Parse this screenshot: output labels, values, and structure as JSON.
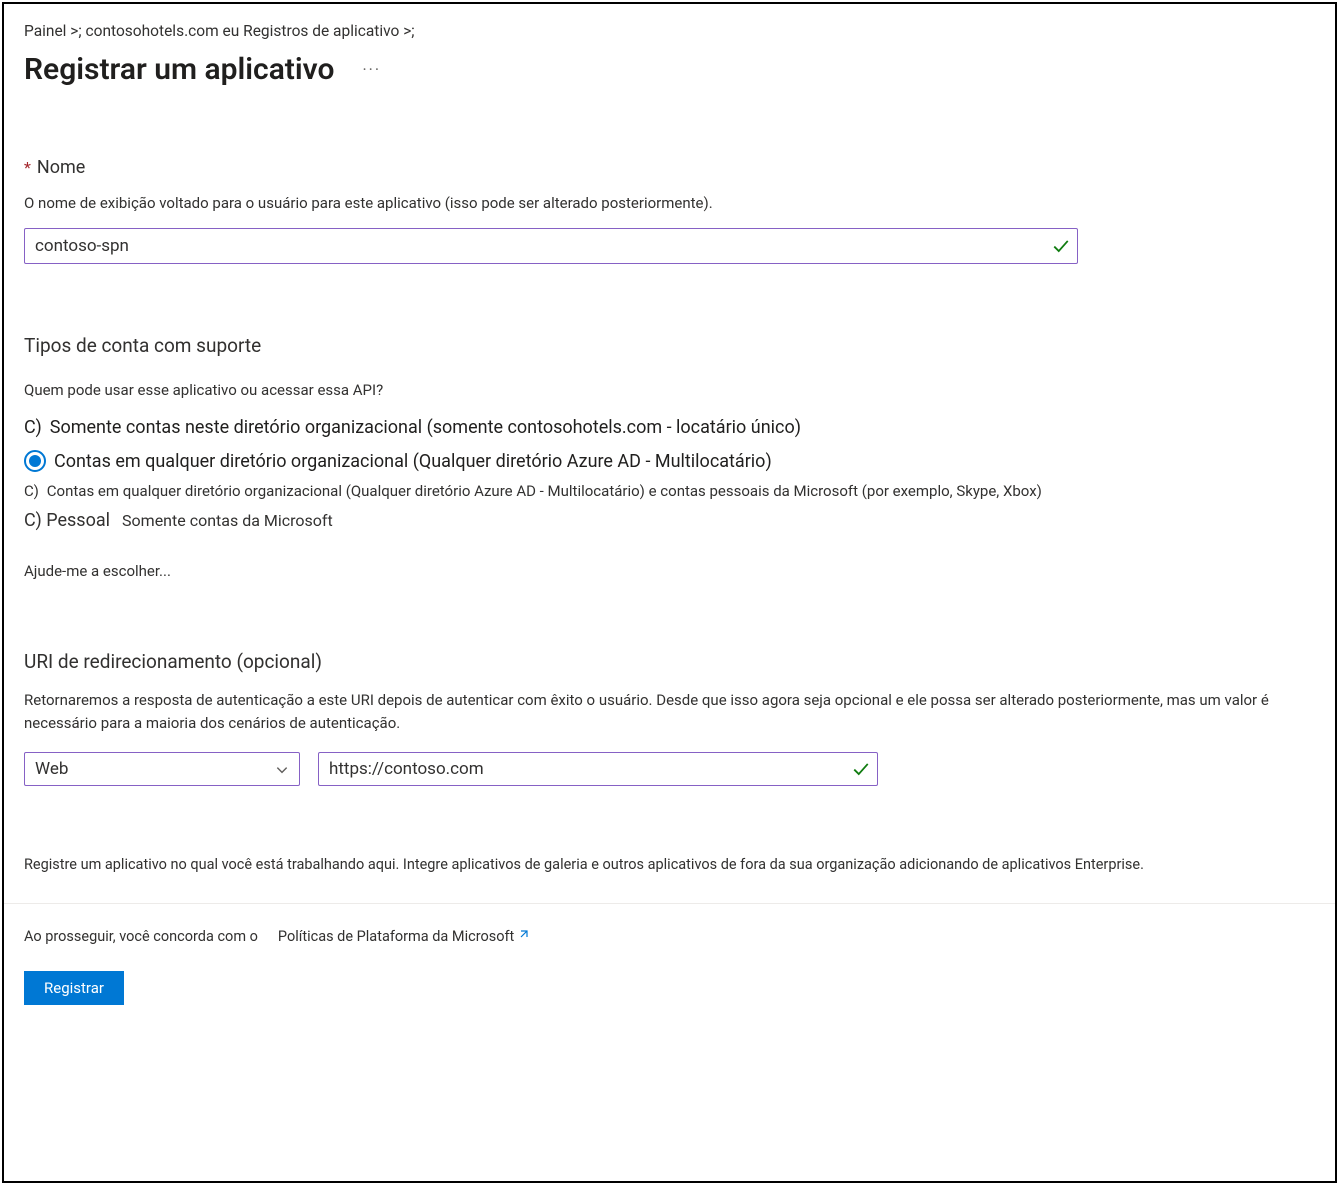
{
  "breadcrumb": "Painel >; contosohotels.com eu Registros de aplicativo >;",
  "page_title": "Registrar um aplicativo",
  "more_icon_name": "more-horizontal-icon",
  "name_section": {
    "required_star": "*",
    "label": "Nome",
    "description": "O nome de exibição voltado para o usuário para este aplicativo (isso pode ser alterado posteriormente).",
    "value": "contoso-spn"
  },
  "account_types": {
    "heading": "Tipos de conta com suporte",
    "sub": "Quem pode usar esse aplicativo ou acessar essa API?",
    "options": {
      "single_tenant_prefix": "C)",
      "single_tenant": "Somente contas neste diretório organizacional (somente contosohotels.com - locatário único)",
      "multi_tenant": "Contas em qualquer diretório organizacional (Qualquer diretório Azure AD - Multilocatário)",
      "multi_tenant_personal_prefix": "C)",
      "multi_tenant_personal": "Contas em qualquer diretório organizacional (Qualquer diretório Azure AD - Multilocatário) e contas pessoais da Microsoft (por exemplo, Skype, Xbox)",
      "personal_prefix": "C) Pessoal",
      "personal_sub": "Somente contas da Microsoft"
    },
    "help_link": "Ajude-me a escolher..."
  },
  "redirect": {
    "heading": "URI de redirecionamento (opcional)",
    "description": "Retornaremos a resposta de autenticação a este URI depois de autenticar com êxito o usuário. Desde que isso agora seja opcional e ele possa ser alterado posteriormente, mas um valor é necessário para a maioria dos cenários de autenticação.",
    "platform_selected": "Web",
    "url_value": "https://contoso.com"
  },
  "footnote": "Registre um aplicativo no qual você está trabalhando aqui. Integre aplicativos de galeria e outros aplicativos de fora da sua organização adicionando de aplicativos Enterprise.",
  "agree_text": "Ao prosseguir, você concorda com o",
  "policy_link": "Políticas de Plataforma da Microsoft",
  "register_button": "Registrar"
}
